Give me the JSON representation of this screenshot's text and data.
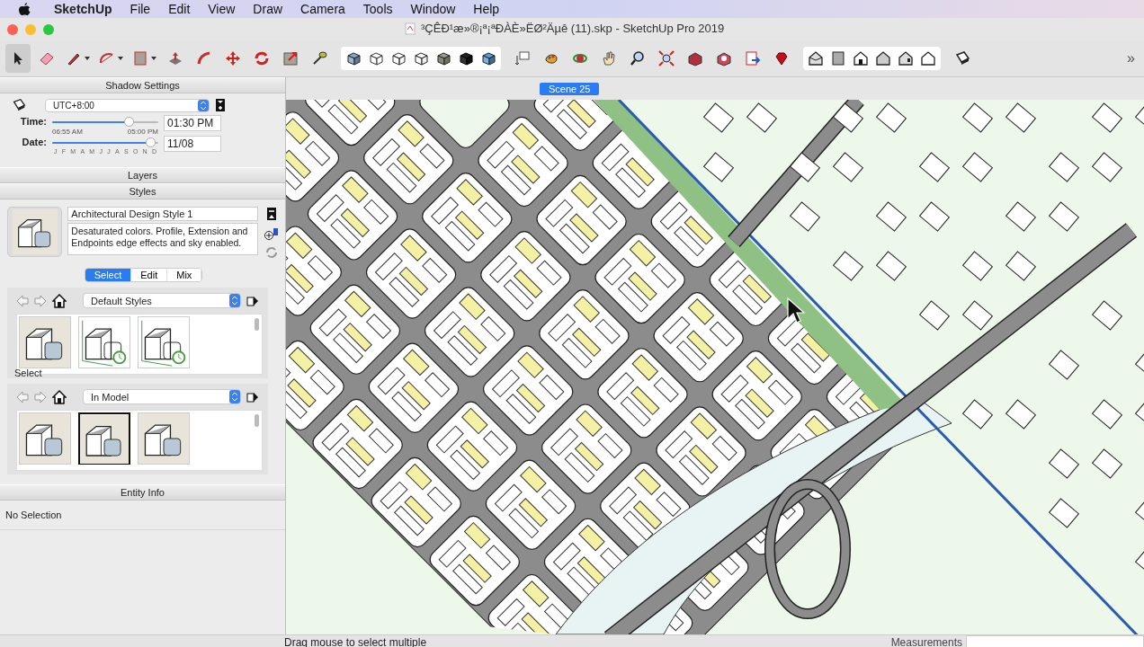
{
  "menu_bar": {
    "app": "SketchUp",
    "items": [
      "File",
      "Edit",
      "View",
      "Draw",
      "Camera",
      "Tools",
      "Window",
      "Help"
    ]
  },
  "window": {
    "title": "³ÇÊÐ¹æ»®¡ª¡ªÐÀÈ»ËØ²Äµê (11).skp - SketchUp Pro 2019"
  },
  "toolbar": {
    "sections": [
      {
        "kind": "plain",
        "tools": [
          {
            "kind": "select",
            "selected": true,
            "has_menu": false
          },
          {
            "kind": "eraser",
            "selected": false,
            "has_menu": false
          },
          {
            "kind": "pencil",
            "selected": false,
            "has_menu": true
          },
          {
            "kind": "arc",
            "selected": false,
            "has_menu": true
          },
          {
            "kind": "rect",
            "selected": false,
            "has_menu": true
          },
          {
            "kind": "pushpull",
            "selected": false,
            "has_menu": false
          },
          {
            "kind": "followme",
            "selected": false,
            "has_menu": false
          },
          {
            "kind": "move",
            "selected": false,
            "has_menu": false
          },
          {
            "kind": "rotate",
            "selected": false,
            "has_menu": false
          },
          {
            "kind": "scale",
            "selected": false,
            "has_menu": false
          },
          {
            "kind": "tape",
            "selected": false,
            "has_menu": false
          }
        ]
      },
      {
        "kind": "segmented",
        "tools": [
          {
            "kind": "xray",
            "selected": false,
            "has_menu": false
          },
          {
            "kind": "backedges",
            "selected": false,
            "has_menu": false
          },
          {
            "kind": "wireframe",
            "selected": false,
            "has_menu": false
          },
          {
            "kind": "hiddenline",
            "selected": false,
            "has_menu": false
          },
          {
            "kind": "shaded",
            "selected": false,
            "has_menu": false
          },
          {
            "kind": "textured",
            "selected": false,
            "has_menu": false
          },
          {
            "kind": "monochrome",
            "selected": false,
            "has_menu": false
          }
        ]
      },
      {
        "kind": "plain",
        "tools": [
          {
            "kind": "text",
            "selected": false,
            "has_menu": false
          },
          {
            "kind": "paint",
            "selected": false,
            "has_menu": false
          },
          {
            "kind": "orbit",
            "selected": false,
            "has_menu": false
          },
          {
            "kind": "pan",
            "selected": false,
            "has_menu": false
          },
          {
            "kind": "zoom",
            "selected": false,
            "has_menu": false
          },
          {
            "kind": "zoomext",
            "selected": false,
            "has_menu": false
          },
          {
            "kind": "warehouse",
            "selected": false,
            "has_menu": false
          },
          {
            "kind": "extension",
            "selected": false,
            "has_menu": false
          },
          {
            "kind": "sendto",
            "selected": false,
            "has_menu": false
          },
          {
            "kind": "ruby",
            "selected": false,
            "has_menu": false
          }
        ]
      },
      {
        "kind": "segmented",
        "tools": [
          {
            "kind": "iso",
            "selected": false,
            "has_menu": false
          },
          {
            "kind": "top",
            "selected": false,
            "has_menu": false
          },
          {
            "kind": "front",
            "selected": false,
            "has_menu": false
          },
          {
            "kind": "right",
            "selected": false,
            "has_menu": false
          },
          {
            "kind": "back",
            "selected": false,
            "has_menu": false
          },
          {
            "kind": "left",
            "selected": false,
            "has_menu": false
          }
        ]
      },
      {
        "kind": "plain",
        "tools": [
          {
            "kind": "shadow",
            "selected": false,
            "has_menu": false
          }
        ]
      }
    ],
    "overflow": "»"
  },
  "shadow_settings": {
    "title": "Shadow Settings",
    "timezone": "UTC+8:00",
    "time_label": "Time:",
    "time_slider": {
      "level": 0.73,
      "start": "06:55 AM",
      "end": "05:00 PM"
    },
    "time": "01:30 PM",
    "date_label": "Date:",
    "date_slider": {
      "level": 0.93,
      "months": [
        "J",
        "F",
        "M",
        "A",
        "M",
        "J",
        "J",
        "A",
        "S",
        "O",
        "N",
        "D"
      ]
    },
    "date": "11/08"
  },
  "layers": {
    "title": "Layers"
  },
  "styles": {
    "title": "Styles",
    "name": "Architectural Design Style 1",
    "description": "Desaturated colors. Profile, Extension and Endpoints edge effects and sky enabled.",
    "tabs": [
      {
        "label": "Select",
        "selected": true
      },
      {
        "label": "Edit",
        "selected": false
      },
      {
        "label": "Mix",
        "selected": false
      }
    ],
    "collections": [
      {
        "name": "Default Styles",
        "tooltip": "Select",
        "thumbnails": [
          {
            "kind": "shaded",
            "selected": false
          },
          {
            "kind": "sketch",
            "selected": false
          },
          {
            "kind": "sketch",
            "selected": false
          }
        ]
      },
      {
        "name": "In Model",
        "thumbnails": [
          {
            "kind": "shaded",
            "selected": false
          },
          {
            "kind": "shaded",
            "selected": true
          },
          {
            "kind": "shaded",
            "selected": false
          }
        ]
      }
    ]
  },
  "entity_info": {
    "title": "Entity Info",
    "text": "No Selection"
  },
  "scenes": [
    {
      "label": "Scene 25",
      "selected": true
    }
  ],
  "status_bar": {
    "hint": "Drag mouse to select multiple",
    "measurements_label": "Measurements"
  }
}
